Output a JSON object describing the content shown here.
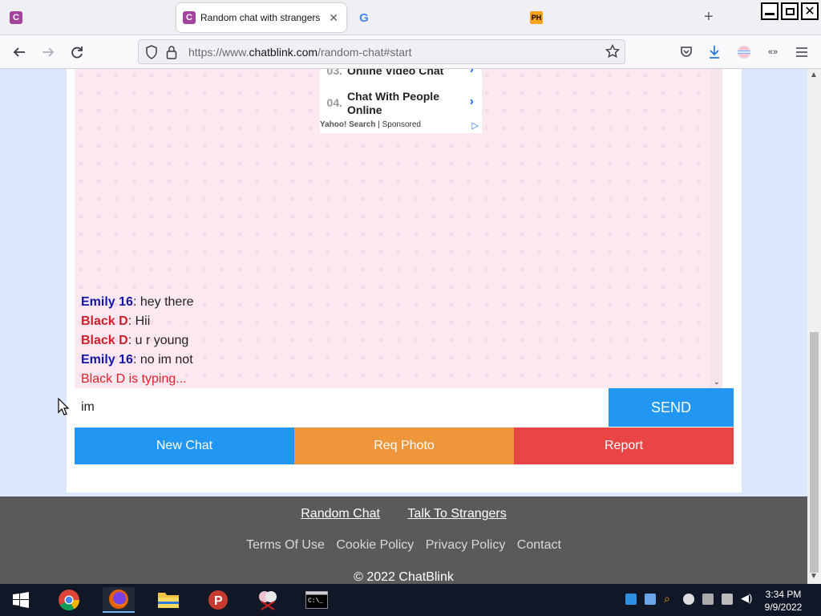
{
  "browser": {
    "tabs": [
      {
        "title": ""
      },
      {
        "title": "Random chat with strangers"
      },
      {
        "title": ""
      },
      {
        "title": ""
      }
    ],
    "url_prefix": "https://www.",
    "url_domain": "chatblink.com",
    "url_path": "/random-chat#start"
  },
  "ad": {
    "items": [
      {
        "num": "03.",
        "text": "Online Video Chat"
      },
      {
        "num": "04.",
        "text": "Chat With People Online"
      }
    ],
    "footer_brand": "Yahoo! Search",
    "footer_sep": " | ",
    "footer_label": "Sponsored"
  },
  "chat": {
    "messages": [
      {
        "name": "Emily 16",
        "text": ": hey there"
      },
      {
        "name": "Black D",
        "text": ": Hii"
      },
      {
        "name": "Black D",
        "text": ": u r young"
      },
      {
        "name": "Emily 16",
        "text": ": no im not"
      }
    ],
    "typing": "Black D is typing...",
    "input_value": "im",
    "send_label": "SEND",
    "buttons": {
      "new_chat": "New Chat",
      "req_photo": "Req Photo",
      "report": "Report"
    }
  },
  "footer": {
    "links_primary": [
      "Random Chat",
      "Talk To Strangers"
    ],
    "links_secondary": [
      "Terms Of Use",
      "Cookie Policy",
      "Privacy Policy",
      "Contact"
    ],
    "copyright": "© 2022 ChatBlink"
  },
  "taskbar": {
    "time": "3:34 PM",
    "date": "9/9/2022"
  },
  "colors": {
    "accent_blue": "#2196f3",
    "accent_orange": "#f0963a",
    "accent_red": "#e94545",
    "name_blue": "#1515a8",
    "name_red": "#d0202a"
  }
}
